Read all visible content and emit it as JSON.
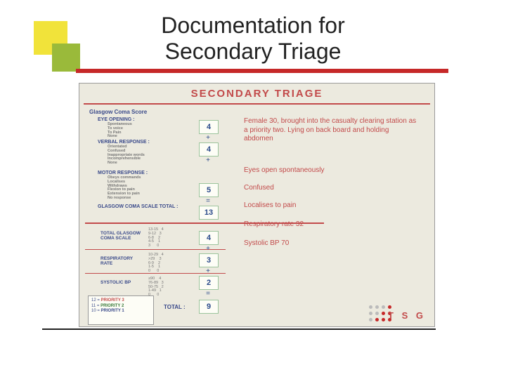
{
  "title_line1": "Documentation for",
  "title_line2": "Secondary Triage",
  "sheet": {
    "heading": "SECONDARY TRIAGE",
    "gcs_heading": "Glasgow Coma Score",
    "eye": {
      "label": "EYE OPENING :",
      "items": "Spontaneous\nTo voice\nTo Pain\nNone",
      "value": "4"
    },
    "verbal": {
      "label": "VERBAL RESPONSE :",
      "items": "Orientated\nConfused\nInappropriate words\nIncomprehensible\nNone",
      "value": "4"
    },
    "motor": {
      "label": "MOTOR RESPONSE :",
      "items": "Obeys commands\nLocalises\nWithdraws\nFlexion to pain\nExtension to pain\nNo response",
      "value": "5"
    },
    "gcs_total_label": "GLASGOW COMA SCALE TOTAL :",
    "gcs_total": "13",
    "op_plus": "+",
    "op_eq": "=",
    "scenario": "Female 30, brought into the casualty clearing station as a priority two. Lying on back board and holding abdomen",
    "obs": {
      "eyes": "Eyes open spontaneously",
      "confused": "Confused",
      "localises": "Localises to pain",
      "resp": "Respiratory rate 32",
      "sbp": "Systolic BP 70"
    },
    "lower": {
      "gcs_row": {
        "label": "TOTAL GLASGOW COMA SCALE",
        "scale": "13-15   4\n9-12   3\n6-8    2\n4-5    1\n3      0",
        "value": "4"
      },
      "resp_row": {
        "label": "RESPIRATORY RATE",
        "scale": "10-29   4\n>29    3\n6-9    2\n1-5    1\n0      0",
        "value": "3"
      },
      "sbp_row": {
        "label": "SYSTOLIC BP",
        "scale": "≥90    4\n76-89   3\n50-75   2\n1-49   1\n0      0",
        "value": "2"
      },
      "total_label": "TOTAL :",
      "total": "9"
    },
    "key": {
      "l1a": "12  =",
      "l1b": "PRIORITY 3",
      "l2a": "11  =",
      "l2b": "PRIORITY 2",
      "l3a": "10  =",
      "l3b": "PRIORITY 1"
    },
    "tsg": "T S G"
  }
}
